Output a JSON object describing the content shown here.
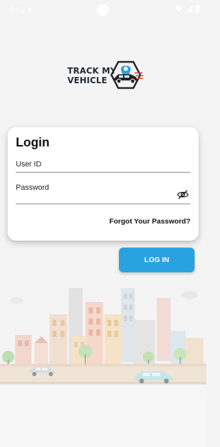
{
  "status_bar": {
    "time": "6:51",
    "icons": [
      "notification-dot-icon",
      "wifi-icon",
      "signal-icon",
      "battery-icon"
    ]
  },
  "logo": {
    "line1": "TRACK MY",
    "line2": "VEHICLE"
  },
  "login_card": {
    "title": "Login",
    "userid": {
      "label": "User ID",
      "value": ""
    },
    "password": {
      "label": "Password",
      "value": "",
      "visibility_icon": "eye-off-icon"
    },
    "forgot_password": "Forgot Your Password?"
  },
  "login_button": {
    "label": "LOG IN"
  },
  "colors": {
    "primary": "#29a3e0",
    "background": "#f4f4f4",
    "card": "#ffffff",
    "text": "#111111"
  }
}
